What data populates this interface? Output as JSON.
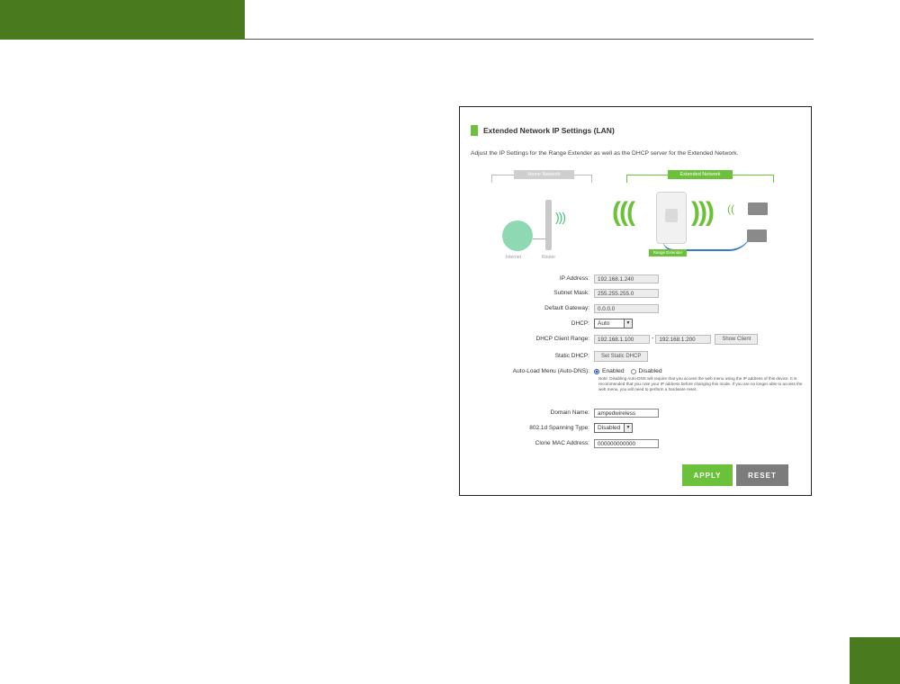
{
  "colors": {
    "brand_green": "#4a7a1e",
    "accent_green": "#6cc13b",
    "reset_gray": "#7c7c7c",
    "cable_blue": "#3b78c4"
  },
  "section": {
    "title": "Extended Network IP Settings (LAN)",
    "description": "Adjust the IP Settings for the Range Extender as well as the DHCP server for the Extended Network."
  },
  "diagram": {
    "home_network_label": "Home Network",
    "extended_network_label": "Extended Network",
    "internet_label": "Internet",
    "router_label": "Router",
    "range_extender_label": "Range Extender"
  },
  "form": {
    "ip_address": {
      "label": "IP Address:",
      "value": "192.168.1.240"
    },
    "subnet_mask": {
      "label": "Subnet Mask:",
      "value": "255.255.255.0"
    },
    "default_gateway": {
      "label": "Default Gateway:",
      "value": "0.0.0.0"
    },
    "dhcp": {
      "label": "DHCP:",
      "value": "Auto"
    },
    "dhcp_client_range": {
      "label": "DHCP Client Range:",
      "start": "192.168.1.100",
      "separator": "-",
      "end": "192.168.1.200",
      "button": "Show Client"
    },
    "static_dhcp": {
      "label": "Static DHCP:",
      "button": "Set Static DHCP"
    },
    "auto_load_menu": {
      "label": "Auto-Load Menu (Auto-DNS):",
      "option_enabled": "Enabled",
      "option_disabled": "Disabled",
      "selected": "Enabled",
      "note": "Note: Disabling Auto-DNS will require that you access the web menu using the IP address of this device. It is recommended that you note your IP address before changing this mode. If you are no longer able to access the web menu, you will need to perform a hardware reset."
    },
    "domain_name": {
      "label": "Domain Name:",
      "value": "ampedwireless"
    },
    "spanning_type": {
      "label": "802.1d Spanning Type:",
      "value": "Disabled"
    },
    "clone_mac": {
      "label": "Clone MAC Address:",
      "value": "000000000000"
    }
  },
  "buttons": {
    "apply": "APPLY",
    "reset": "RESET"
  },
  "icons": {
    "dropdown": "chevron-down-icon"
  }
}
